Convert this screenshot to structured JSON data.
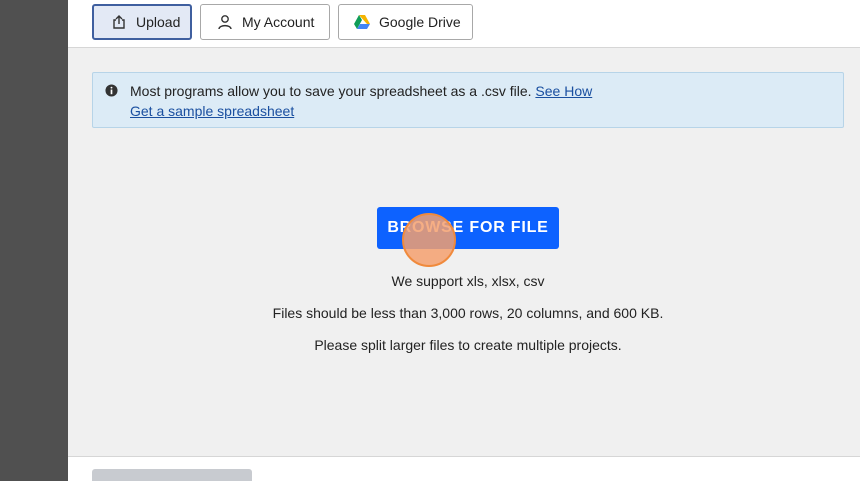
{
  "tabs": {
    "upload": {
      "label": "Upload",
      "icon": "upload-icon",
      "active": true
    },
    "account": {
      "label": "My Account",
      "icon": "person-icon"
    },
    "drive": {
      "label": "Google Drive",
      "icon": "google-drive-icon"
    }
  },
  "info": {
    "icon": "info-icon",
    "message": "Most programs allow you to save your spreadsheet as a .csv file.",
    "see_how_link": "See How",
    "sample_link": "Get a sample spreadsheet"
  },
  "browse": {
    "label": "BROWSE FOR FILE"
  },
  "support": {
    "formats": "We support xls, xlsx, csv",
    "limits": "Files should be less than 3,000 rows, 20 columns, and 600 KB.",
    "split": "Please split larger files to create multiple projects."
  },
  "colors": {
    "primary_button": "#0d62ff",
    "active_tab_border": "#3f5f9f",
    "info_background": "#dcebf6",
    "link": "#1a4fa0"
  }
}
